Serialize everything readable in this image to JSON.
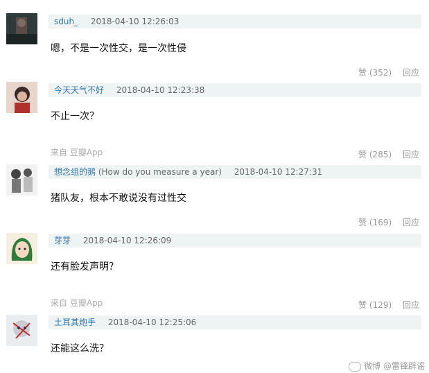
{
  "comments": [
    {
      "author": "sduh_",
      "author_sub": "",
      "time": "2018-04-10 12:26:03",
      "text": "嗯，不是一次性交，是一次性侵",
      "source": "",
      "likes": "赞 (352)",
      "reply": "回应"
    },
    {
      "author": "今天天气不好",
      "author_sub": "",
      "time": "2018-04-10 12:23:38",
      "text": "不止一次？",
      "source": "来自 豆瓣App",
      "likes": "赞 (285)",
      "reply": "回应"
    },
    {
      "author": "想念组的鹅",
      "author_sub": "(How do you measure a year)",
      "time": "2018-04-10 12:27:31",
      "text": "猪队友，根本不敢说没有过性交",
      "source": "",
      "likes": "赞 (169)",
      "reply": "回应"
    },
    {
      "author": "芽芽",
      "author_sub": "",
      "time": "2018-04-10 12:26:09",
      "text": "还有脸发声明？",
      "source": "来自 豆瓣App",
      "likes": "赞 (129)",
      "reply": "回应"
    },
    {
      "author": "土耳其炮手",
      "author_sub": "",
      "time": "2018-04-10 12:25:06",
      "text": "还能这么洗？",
      "source": "",
      "likes": "",
      "reply": ""
    }
  ],
  "watermark": "微博 @雷锋辟谣",
  "colors": {
    "meta_bg": "#eef4f4",
    "author": "#3377aa",
    "muted": "#999999"
  }
}
